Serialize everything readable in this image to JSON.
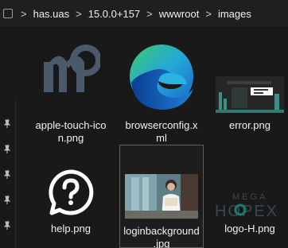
{
  "breadcrumb": {
    "items": [
      "has.uas",
      "15.0.0+157",
      "wwwroot",
      "images"
    ],
    "separator": ">"
  },
  "files": [
    {
      "name_line1": "apple-touch-ico",
      "name_line2": "n.png",
      "icon": "m-logo-thumbnail"
    },
    {
      "name_line1": "browserconfig.x",
      "name_line2": "ml",
      "icon": "edge-browser-icon"
    },
    {
      "name_line1": "error.png",
      "name_line2": "",
      "icon": "error-thumbnail"
    },
    {
      "name_line1": "help.png",
      "name_line2": "",
      "icon": "help-question-icon"
    },
    {
      "name_line1": "loginbackground",
      "name_line2": ".jpg",
      "icon": "login-photo-thumbnail"
    },
    {
      "name_line1": "logo-H.png",
      "name_line2": "",
      "icon": "megahopex-logo-thumbnail"
    }
  ],
  "logo_text": {
    "top": "MEGA",
    "bottom": "HOPEX"
  },
  "colors": {
    "background": "#191919",
    "breadcrumb_bg": "#1f1f1f",
    "apple_icon": "#4a5a6a",
    "selection_border": "#5f5f5f"
  }
}
